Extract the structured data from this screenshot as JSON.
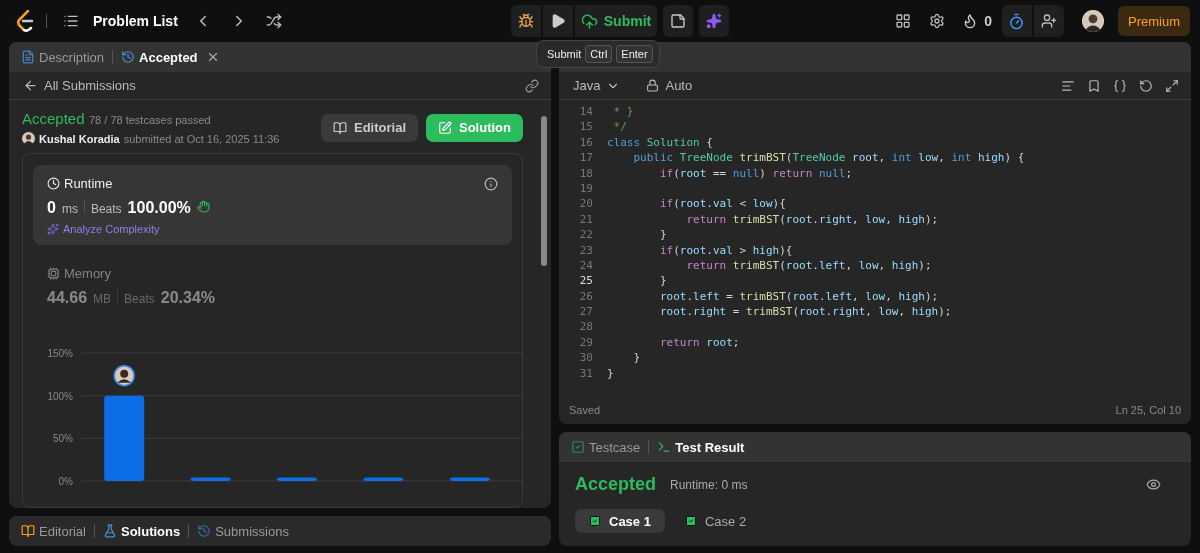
{
  "top_bar": {
    "problem_list": "Problem List",
    "submit": "Submit",
    "streak": "0",
    "timer_on": true,
    "premium": "Premium"
  },
  "tooltip": {
    "label": "Submit",
    "keys": [
      "Ctrl",
      "Enter"
    ]
  },
  "left_tabs": [
    {
      "label": "Description",
      "kind": "description",
      "selected": false
    },
    {
      "label": "Accepted",
      "kind": "history",
      "selected": true
    }
  ],
  "submission": {
    "back": "All Submissions",
    "status": "Accepted",
    "passed": "78 / 78 testcases passed",
    "author": "Kushal Koradia",
    "submitted": "submitted at Oct 16, 2025 11:36",
    "buttons": [
      {
        "label": "Editorial",
        "kind": "editorial"
      },
      {
        "label": "Solution",
        "kind": "solution"
      }
    ]
  },
  "metrics": [
    {
      "title": "Runtime",
      "kind": "runtime",
      "value": "0",
      "unit": "ms",
      "beats_label": "Beats",
      "beats": "100.00%",
      "selected": true,
      "link": "Analyze Complexity"
    },
    {
      "title": "Memory",
      "kind": "memory",
      "value": "44.66",
      "unit": "MB",
      "beats_label": "Beats",
      "beats": "20.34%",
      "selected": false
    }
  ],
  "chart_data": {
    "type": "bar",
    "values": [
      100,
      4,
      4,
      4,
      4
    ],
    "ylim": [
      0,
      150
    ],
    "yticks": [
      {
        "value": 0,
        "label": "0%"
      },
      {
        "value": 50,
        "label": "50%"
      },
      {
        "value": 100,
        "label": "100%"
      },
      {
        "value": 150,
        "label": "150%"
      }
    ]
  },
  "bottom_tabs": [
    {
      "label": "Editorial",
      "kind": "editorial",
      "selected": false
    },
    {
      "label": "Solutions",
      "kind": "solutions",
      "selected": true
    },
    {
      "label": "Submissions",
      "kind": "submissions",
      "selected": false
    }
  ],
  "editor": {
    "language": "Java",
    "mode": "Auto",
    "status": "Saved",
    "cursor": "Ln 25, Col 10",
    "lines": [
      {
        "number": "14",
        "current": false,
        "tokens": [
          {
            "kind": "comment",
            "text": " * }"
          }
        ]
      },
      {
        "number": "15",
        "current": false,
        "tokens": [
          {
            "kind": "comment",
            "text": " */"
          }
        ]
      },
      {
        "number": "16",
        "current": false,
        "tokens": [
          {
            "kind": "keyword",
            "text": "class"
          },
          {
            "kind": "type",
            "text": " Solution"
          },
          {
            "kind": "plain",
            "text": " {"
          }
        ]
      },
      {
        "number": "17",
        "current": false,
        "tokens": [
          {
            "kind": "keyword",
            "text": "    public"
          },
          {
            "kind": "type",
            "text": " TreeNode"
          },
          {
            "kind": "func",
            "text": " trimBST"
          },
          {
            "kind": "plain",
            "text": "("
          },
          {
            "kind": "type",
            "text": "TreeNode"
          },
          {
            "kind": "var",
            "text": " root"
          },
          {
            "kind": "plain",
            "text": ", "
          },
          {
            "kind": "keyword",
            "text": "int"
          },
          {
            "kind": "var",
            "text": " low"
          },
          {
            "kind": "plain",
            "text": ", "
          },
          {
            "kind": "keyword",
            "text": "int"
          },
          {
            "kind": "var",
            "text": " high"
          },
          {
            "kind": "plain",
            "text": ") {"
          }
        ]
      },
      {
        "number": "18",
        "current": false,
        "tokens": [
          {
            "kind": "control",
            "text": "        if"
          },
          {
            "kind": "plain",
            "text": "("
          },
          {
            "kind": "var",
            "text": "root"
          },
          {
            "kind": "plain",
            "text": " == "
          },
          {
            "kind": "keyword",
            "text": "null"
          },
          {
            "kind": "plain",
            "text": ") "
          },
          {
            "kind": "control",
            "text": "return"
          },
          {
            "kind": "keyword",
            "text": " null"
          },
          {
            "kind": "plain",
            "text": ";"
          }
        ]
      },
      {
        "number": "19",
        "current": false
      },
      {
        "number": "20",
        "current": false,
        "tokens": [
          {
            "kind": "control",
            "text": "        if"
          },
          {
            "kind": "plain",
            "text": "("
          },
          {
            "kind": "var",
            "text": "root"
          },
          {
            "kind": "plain",
            "text": "."
          },
          {
            "kind": "var",
            "text": "val"
          },
          {
            "kind": "plain",
            "text": " < "
          },
          {
            "kind": "var",
            "text": "low"
          },
          {
            "kind": "plain",
            "text": "){"
          }
        ]
      },
      {
        "number": "21",
        "current": false,
        "tokens": [
          {
            "kind": "control",
            "text": "            return"
          },
          {
            "kind": "func",
            "text": " trimBST"
          },
          {
            "kind": "plain",
            "text": "("
          },
          {
            "kind": "var",
            "text": "root"
          },
          {
            "kind": "plain",
            "text": "."
          },
          {
            "kind": "var",
            "text": "right"
          },
          {
            "kind": "plain",
            "text": ", "
          },
          {
            "kind": "var",
            "text": "low"
          },
          {
            "kind": "plain",
            "text": ", "
          },
          {
            "kind": "var",
            "text": "high"
          },
          {
            "kind": "plain",
            "text": ");"
          }
        ]
      },
      {
        "number": "22",
        "current": false,
        "tokens": [
          {
            "kind": "plain",
            "text": "        }"
          }
        ]
      },
      {
        "number": "23",
        "current": false,
        "tokens": [
          {
            "kind": "control",
            "text": "        if"
          },
          {
            "kind": "plain",
            "text": "("
          },
          {
            "kind": "var",
            "text": "root"
          },
          {
            "kind": "plain",
            "text": "."
          },
          {
            "kind": "var",
            "text": "val"
          },
          {
            "kind": "plain",
            "text": " > "
          },
          {
            "kind": "var",
            "text": "high"
          },
          {
            "kind": "plain",
            "text": "){"
          }
        ]
      },
      {
        "number": "24",
        "current": false,
        "tokens": [
          {
            "kind": "control",
            "text": "            return"
          },
          {
            "kind": "func",
            "text": " trimBST"
          },
          {
            "kind": "plain",
            "text": "("
          },
          {
            "kind": "var",
            "text": "root"
          },
          {
            "kind": "plain",
            "text": "."
          },
          {
            "kind": "var",
            "text": "left"
          },
          {
            "kind": "plain",
            "text": ", "
          },
          {
            "kind": "var",
            "text": "low"
          },
          {
            "kind": "plain",
            "text": ", "
          },
          {
            "kind": "var",
            "text": "high"
          },
          {
            "kind": "plain",
            "text": ");"
          }
        ]
      },
      {
        "number": "25",
        "current": true,
        "tokens": [
          {
            "kind": "plain",
            "text": "        }"
          }
        ]
      },
      {
        "number": "26",
        "current": false,
        "tokens": [
          {
            "kind": "var",
            "text": "        root"
          },
          {
            "kind": "plain",
            "text": "."
          },
          {
            "kind": "var",
            "text": "left"
          },
          {
            "kind": "plain",
            "text": " = "
          },
          {
            "kind": "func",
            "text": "trimBST"
          },
          {
            "kind": "plain",
            "text": "("
          },
          {
            "kind": "var",
            "text": "root"
          },
          {
            "kind": "plain",
            "text": "."
          },
          {
            "kind": "var",
            "text": "left"
          },
          {
            "kind": "plain",
            "text": ", "
          },
          {
            "kind": "var",
            "text": "low"
          },
          {
            "kind": "plain",
            "text": ", "
          },
          {
            "kind": "var",
            "text": "high"
          },
          {
            "kind": "plain",
            "text": ");"
          }
        ]
      },
      {
        "number": "27",
        "current": false,
        "tokens": [
          {
            "kind": "var",
            "text": "        root"
          },
          {
            "kind": "plain",
            "text": "."
          },
          {
            "kind": "var",
            "text": "right"
          },
          {
            "kind": "plain",
            "text": " = "
          },
          {
            "kind": "func",
            "text": "trimBST"
          },
          {
            "kind": "plain",
            "text": "("
          },
          {
            "kind": "var",
            "text": "root"
          },
          {
            "kind": "plain",
            "text": "."
          },
          {
            "kind": "var",
            "text": "right"
          },
          {
            "kind": "plain",
            "text": ", "
          },
          {
            "kind": "var",
            "text": "low"
          },
          {
            "kind": "plain",
            "text": ", "
          },
          {
            "kind": "var",
            "text": "high"
          },
          {
            "kind": "plain",
            "text": ");"
          }
        ]
      },
      {
        "number": "28",
        "current": false
      },
      {
        "number": "29",
        "current": false,
        "tokens": [
          {
            "kind": "control",
            "text": "        return"
          },
          {
            "kind": "var",
            "text": " root"
          },
          {
            "kind": "plain",
            "text": ";"
          }
        ]
      },
      {
        "number": "30",
        "current": false,
        "tokens": [
          {
            "kind": "plain",
            "text": "    }"
          }
        ]
      },
      {
        "number": "31",
        "current": false,
        "tokens": [
          {
            "kind": "plain",
            "text": "}"
          }
        ]
      }
    ]
  },
  "test_tabs": [
    {
      "label": "Testcase",
      "kind": "testcase",
      "selected": false
    },
    {
      "label": "Test Result",
      "kind": "result",
      "selected": true
    }
  ],
  "result": {
    "status": "Accepted",
    "runtime": "Runtime: 0 ms",
    "cases": [
      {
        "label": "Case 1",
        "passed": true,
        "selected": true
      },
      {
        "label": "Case 2",
        "passed": true,
        "selected": false
      }
    ]
  }
}
